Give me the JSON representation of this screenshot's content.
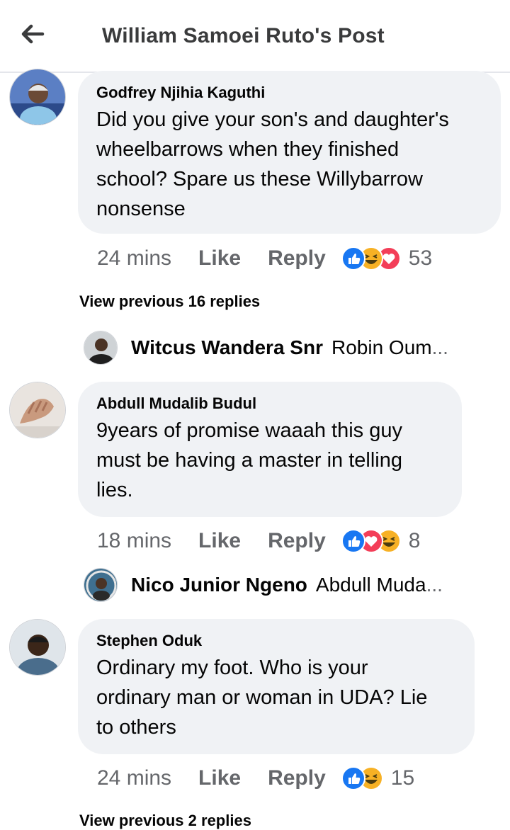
{
  "header": {
    "title": "William Samoei Ruto's Post"
  },
  "comments": [
    {
      "author": "Godfrey Njihia Kaguthi",
      "lines": [
        "Did you give your son's and daughter's",
        "wheelbarrows when they finished",
        "school? Spare us these Willybarrow",
        "nonsense"
      ],
      "time": "24 mins",
      "like": "Like",
      "reply": "Reply",
      "reactions": [
        "like-reaction",
        "haha-reaction",
        "love-reaction"
      ],
      "count": "53"
    },
    {
      "author": "Abdull Mudalib Budul",
      "lines": [
        "9years of promise waaah this guy",
        "must be having a master in telling",
        "lies."
      ],
      "time": "18 mins",
      "like": "Like",
      "reply": "Reply",
      "reactions": [
        "like-reaction",
        "love-reaction",
        "haha-reaction"
      ],
      "count": "8"
    },
    {
      "author": "Stephen Oduk",
      "lines": [
        "Ordinary my foot. Who is your",
        "ordinary man or woman in UDA? Lie",
        "to others"
      ],
      "time": "24 mins",
      "like": "Like",
      "reply": "Reply",
      "reactions": [
        "like-reaction",
        "haha-reaction"
      ],
      "count": "15"
    }
  ],
  "view_previous": [
    "View previous 16 replies",
    "View previous 2 replies"
  ],
  "reply_previews": [
    {
      "name": "Witcus Wandera Snr",
      "snippet": "Robin Oum",
      "ellipsis": "..."
    },
    {
      "name": "Nico Junior Ngeno",
      "snippet": "Abdull Muda",
      "ellipsis": "..."
    }
  ],
  "colors": {
    "like_blue": "#1877f2",
    "love_red": "#f33e58",
    "haha_yellow": "#f7b125",
    "bubble_bg": "#f0f2f5",
    "meta_gray": "#65676b"
  }
}
